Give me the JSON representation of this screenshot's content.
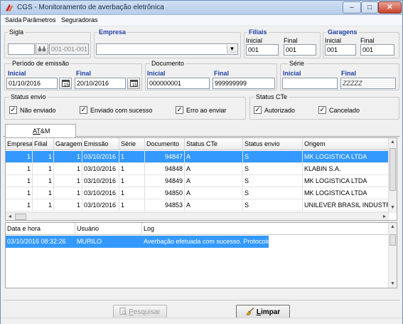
{
  "window": {
    "title": "CGS - Monitoramento de averbação eletrônica",
    "minimize": "–",
    "maximize": "□",
    "close": "✕"
  },
  "menu": [
    "Saída",
    "Parâmetros",
    "Seguradoras"
  ],
  "filters": {
    "sigla": {
      "label": "Sigla",
      "value": "",
      "code": "001-001-001"
    },
    "empresa": {
      "label": "Empresa",
      "value": ""
    },
    "filiais": {
      "label": "Filiais",
      "inicial_label": "Inicial",
      "final_label": "Final",
      "inicial": "001",
      "final": "001"
    },
    "garagens": {
      "label": "Garagens",
      "inicial_label": "Inicial",
      "final_label": "Final",
      "inicial": "001",
      "final": "001"
    },
    "periodo": {
      "label": "Período de emissão",
      "inicial_label": "Inicial",
      "final_label": "Final",
      "inicial": "01/10/2016",
      "final": "20/10/2016"
    },
    "documento": {
      "label": "Documento",
      "inicial_label": "Inicial",
      "final_label": "Final",
      "inicial": "000000001",
      "final": "999999999"
    },
    "serie": {
      "label": "Série",
      "inicial_label": "Inicial",
      "final_label": "Final",
      "inicial": "",
      "final": "ZZZZZ"
    },
    "status_envio": {
      "label": "Status envio",
      "options": [
        {
          "label": "Não enviado",
          "checked": true
        },
        {
          "label": "Enviado com sucesso",
          "checked": true
        },
        {
          "label": "Erro ao enviar",
          "checked": true
        }
      ]
    },
    "status_cte": {
      "label": "Status CTe",
      "options": [
        {
          "label": "Autorizado",
          "checked": true
        },
        {
          "label": "Cancelado",
          "checked": true
        }
      ]
    }
  },
  "tabs": [
    {
      "label_u": "AT",
      "label_rest": "&M"
    }
  ],
  "docs_table": {
    "columns": [
      "Empresa",
      "Filial",
      "Garagem",
      "Emissão",
      "Série",
      "Documento",
      "Status CTe",
      "Status envio",
      "Origem"
    ],
    "rows": [
      {
        "empresa": "1",
        "filial": "1",
        "garagem": "1",
        "emissao": "03/10/2016",
        "serie": "1",
        "documento": "94847",
        "status_cte": "A",
        "status_envio": "S",
        "origem": "MK LOGISTICA LTDA",
        "selected": true
      },
      {
        "empresa": "1",
        "filial": "1",
        "garagem": "1",
        "emissao": "03/10/2016",
        "serie": "1",
        "documento": "94848",
        "status_cte": "A",
        "status_envio": "S",
        "origem": "KLABIN S.A.",
        "selected": false
      },
      {
        "empresa": "1",
        "filial": "1",
        "garagem": "1",
        "emissao": "03/10/2016",
        "serie": "1",
        "documento": "94849",
        "status_cte": "A",
        "status_envio": "S",
        "origem": "MK LOGISTICA LTDA",
        "selected": false
      },
      {
        "empresa": "1",
        "filial": "1",
        "garagem": "1",
        "emissao": "03/10/2016",
        "serie": "1",
        "documento": "94850",
        "status_cte": "A",
        "status_envio": "S",
        "origem": "MK LOGISTICA LTDA",
        "selected": false
      },
      {
        "empresa": "1",
        "filial": "1",
        "garagem": "1",
        "emissao": "03/10/2016",
        "serie": "1",
        "documento": "94853",
        "status_cte": "A",
        "status_envio": "S",
        "origem": "UNILEVER BRASIL INDUSTRIAL",
        "selected": false
      }
    ]
  },
  "log_table": {
    "columns": [
      "Data e hora",
      "Usuário",
      "Log"
    ],
    "rows": [
      {
        "data": "03/10/2016 08:32:26",
        "usuario": "MURILO",
        "log": "Averbação efetuada com sucesso. Protocolo:",
        "selected": true
      }
    ]
  },
  "buttons": {
    "pesquisar_u": "P",
    "pesquisar_rest": "esquisar",
    "limpar_u": "L",
    "limpar_rest": "impar"
  }
}
